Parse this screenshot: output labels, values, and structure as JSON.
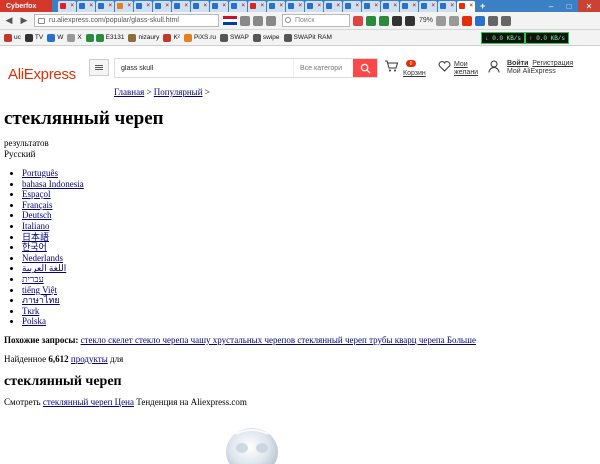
{
  "browser": {
    "app_name": "Cyberfox",
    "url": "ru.aliexpress.com/popular/glass-skull.html",
    "search_placeholder": "Поиск",
    "zoom": "79%",
    "bookmarks": [
      "uc",
      "TV",
      "W",
      "X",
      "E3131",
      "nizaury",
      "K²",
      "PiXS.ru",
      "SWAP",
      "swipe",
      "SWAPit RAM"
    ],
    "speed_down": "0.0 KB/s",
    "speed_up": "0.0 KB/s"
  },
  "header": {
    "logo": "AliExpress",
    "search_value": "glass skull",
    "category_label": "Все категори",
    "cart_count": "0",
    "cart_label": "Корзин",
    "wishlist_label_1": "Мои",
    "wishlist_label_2": "желани",
    "login_label": "Войти",
    "register_label": "Регистрация",
    "my_ae_label": "Мой AliExpress"
  },
  "breadcrumb": {
    "home": "Главная",
    "separator": ">",
    "popular": "Популярный",
    "trail_end": ">"
  },
  "page": {
    "title": "стеклянный череп",
    "results_label": "результатов",
    "current_language": "Русский",
    "languages": [
      "Português",
      "bahasa Indonesia",
      "Espaçol",
      "Français",
      "Deutsch",
      "Italiano",
      "日本語",
      "한국어",
      "Nederlands",
      "اللغة العربية",
      "עברית",
      "tiếng Việt",
      "ภาษาไทย",
      "Tкrk",
      "Polska"
    ],
    "related_label": "Похожие запросы:",
    "related_links": "стекло скелет стекло черепа чашу хрустальных черепов стеклянный череп трубы кварц черепа Больше",
    "found_prefix": "Найденное",
    "found_count": "6,612",
    "found_link": "продукты",
    "found_suffix": "для",
    "subtitle": "стеклянный череп",
    "see_prefix": "Смотреть",
    "see_link": "стеклянный череп Цена",
    "see_suffix": "Тенденция на Aliexpress.com"
  }
}
